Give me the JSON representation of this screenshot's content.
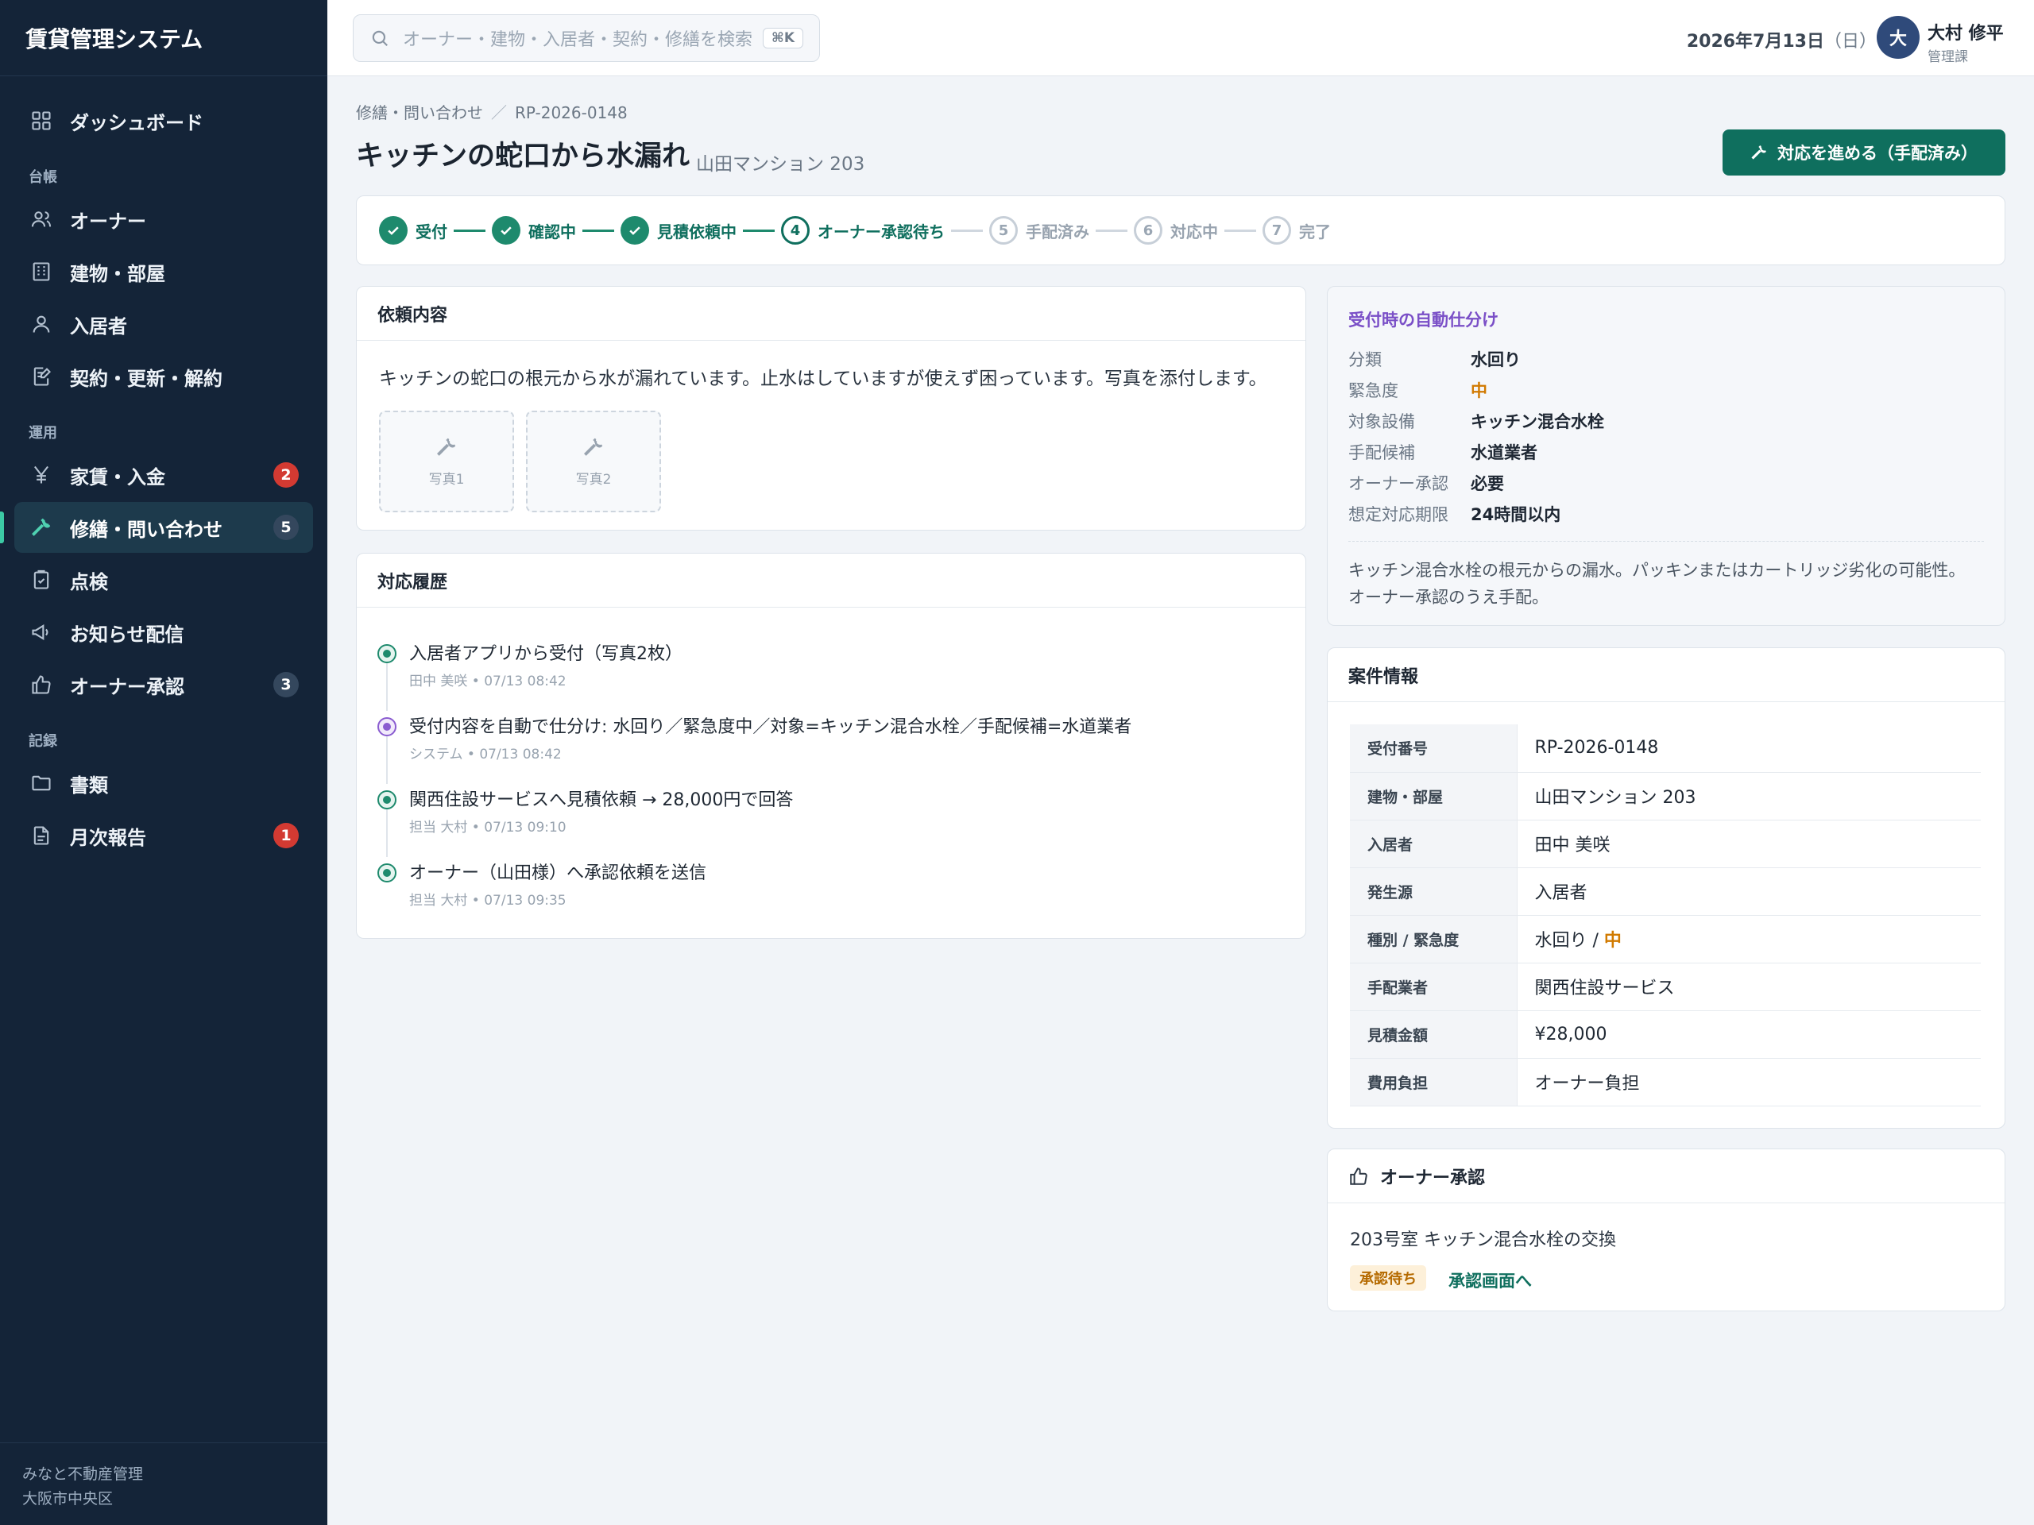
{
  "app": {
    "title": "賃貸管理システム"
  },
  "sidebar": {
    "dashboard": "ダッシュボード",
    "section_ledger": "台帳",
    "owners": "オーナー",
    "buildings": "建物・部屋",
    "tenants": "入居者",
    "contracts": "契約・更新・解約",
    "section_ops": "運用",
    "rent": "家賃・入金",
    "rent_badge": "2",
    "repairs": "修繕・問い合わせ",
    "repairs_badge": "5",
    "inspection": "点検",
    "notices": "お知らせ配信",
    "owner_approval": "オーナー承認",
    "owner_approval_badge": "3",
    "section_records": "記録",
    "documents": "書類",
    "monthly_report": "月次報告",
    "monthly_report_badge": "1",
    "footer_company": "みなと不動産管理",
    "footer_area": "大阪市中央区"
  },
  "topbar": {
    "search_placeholder": "オーナー・建物・入居者・契約・修繕を検索",
    "shortcut": "⌘K",
    "date": "2026年7月13日",
    "weekday": "（日）",
    "avatar_initial": "大",
    "user_name": "大村 修平",
    "user_dept": "管理課"
  },
  "breadcrumb": {
    "parent": "修繕・問い合わせ",
    "sep": "／",
    "current": "RP-2026-0148"
  },
  "page": {
    "title": "キッチンの蛇口から水漏れ",
    "subtitle": "山田マンション 203",
    "action_button": "対応を進める（手配済み）"
  },
  "stepper": {
    "steps": [
      {
        "label": "受付",
        "state": "done",
        "num": "1"
      },
      {
        "label": "確認中",
        "state": "done",
        "num": "2"
      },
      {
        "label": "見積依頼中",
        "state": "done",
        "num": "3"
      },
      {
        "label": "オーナー承認待ち",
        "state": "current",
        "num": "4"
      },
      {
        "label": "手配済み",
        "state": "todo",
        "num": "5"
      },
      {
        "label": "対応中",
        "state": "todo",
        "num": "6"
      },
      {
        "label": "完了",
        "state": "todo",
        "num": "7"
      }
    ]
  },
  "request": {
    "title": "依頼内容",
    "text": "キッチンの蛇口の根元から水が漏れています。止水はしていますが使えず困っています。写真を添付します。",
    "photo1": "写真1",
    "photo2": "写真2"
  },
  "history": {
    "title": "対応履歴",
    "items": [
      {
        "text": "入居者アプリから受付（写真2枚）",
        "meta": "田中 美咲 • 07/13 08:42"
      },
      {
        "text": "受付内容を自動で仕分け: 水回り／緊急度中／対象=キッチン混合水栓／手配候補=水道業者",
        "meta": "システム • 07/13 08:42"
      },
      {
        "text": "関西住設サービスへ見積依頼 → 28,000円で回答",
        "meta": "担当 大村 • 07/13 09:10"
      },
      {
        "text": "オーナー（山田様）へ承認依頼を送信",
        "meta": "担当 大村 • 07/13 09:35"
      }
    ]
  },
  "auto_triage": {
    "title": "受付時の自動仕分け",
    "rows": [
      {
        "k": "分類",
        "v": "水回り"
      },
      {
        "k": "緊急度",
        "v": "中"
      },
      {
        "k": "対象設備",
        "v": "キッチン混合水栓"
      },
      {
        "k": "手配候補",
        "v": "水道業者"
      },
      {
        "k": "オーナー承認",
        "v": "必要"
      },
      {
        "k": "想定対応期限",
        "v": "24時間以内"
      }
    ],
    "note_line1": "キッチン混合水栓の根元からの漏水。パッキンまたはカートリッジ劣化の可能性。",
    "note_line2": "オーナー承認のうえ手配。"
  },
  "case_info": {
    "title": "案件情報",
    "rows": [
      {
        "k": "受付番号",
        "v": "RP-2026-0148"
      },
      {
        "k": "建物・部屋",
        "v": "山田マンション 203"
      },
      {
        "k": "入居者",
        "v": "田中 美咲"
      },
      {
        "k": "発生源",
        "v": "入居者"
      },
      {
        "k": "種別 / 緊急度",
        "v": "水回り / ",
        "v2": "中"
      },
      {
        "k": "手配業者",
        "v": "関西住設サービス"
      },
      {
        "k": "見積金額",
        "v": "¥28,000"
      },
      {
        "k": "費用負担",
        "v": "オーナー負担"
      }
    ]
  },
  "approval": {
    "title": "オーナー承認",
    "text": "203号室 キッチン混合水栓の交換",
    "status": "承認待ち",
    "link": "承認画面へ"
  },
  "colors": {
    "sidebar_bg": "#142438",
    "accent": "#0f6f5e",
    "badge_red": "#d33a32",
    "urgency_orange": "#d17a00",
    "auto_purple": "#7a4fc7"
  }
}
